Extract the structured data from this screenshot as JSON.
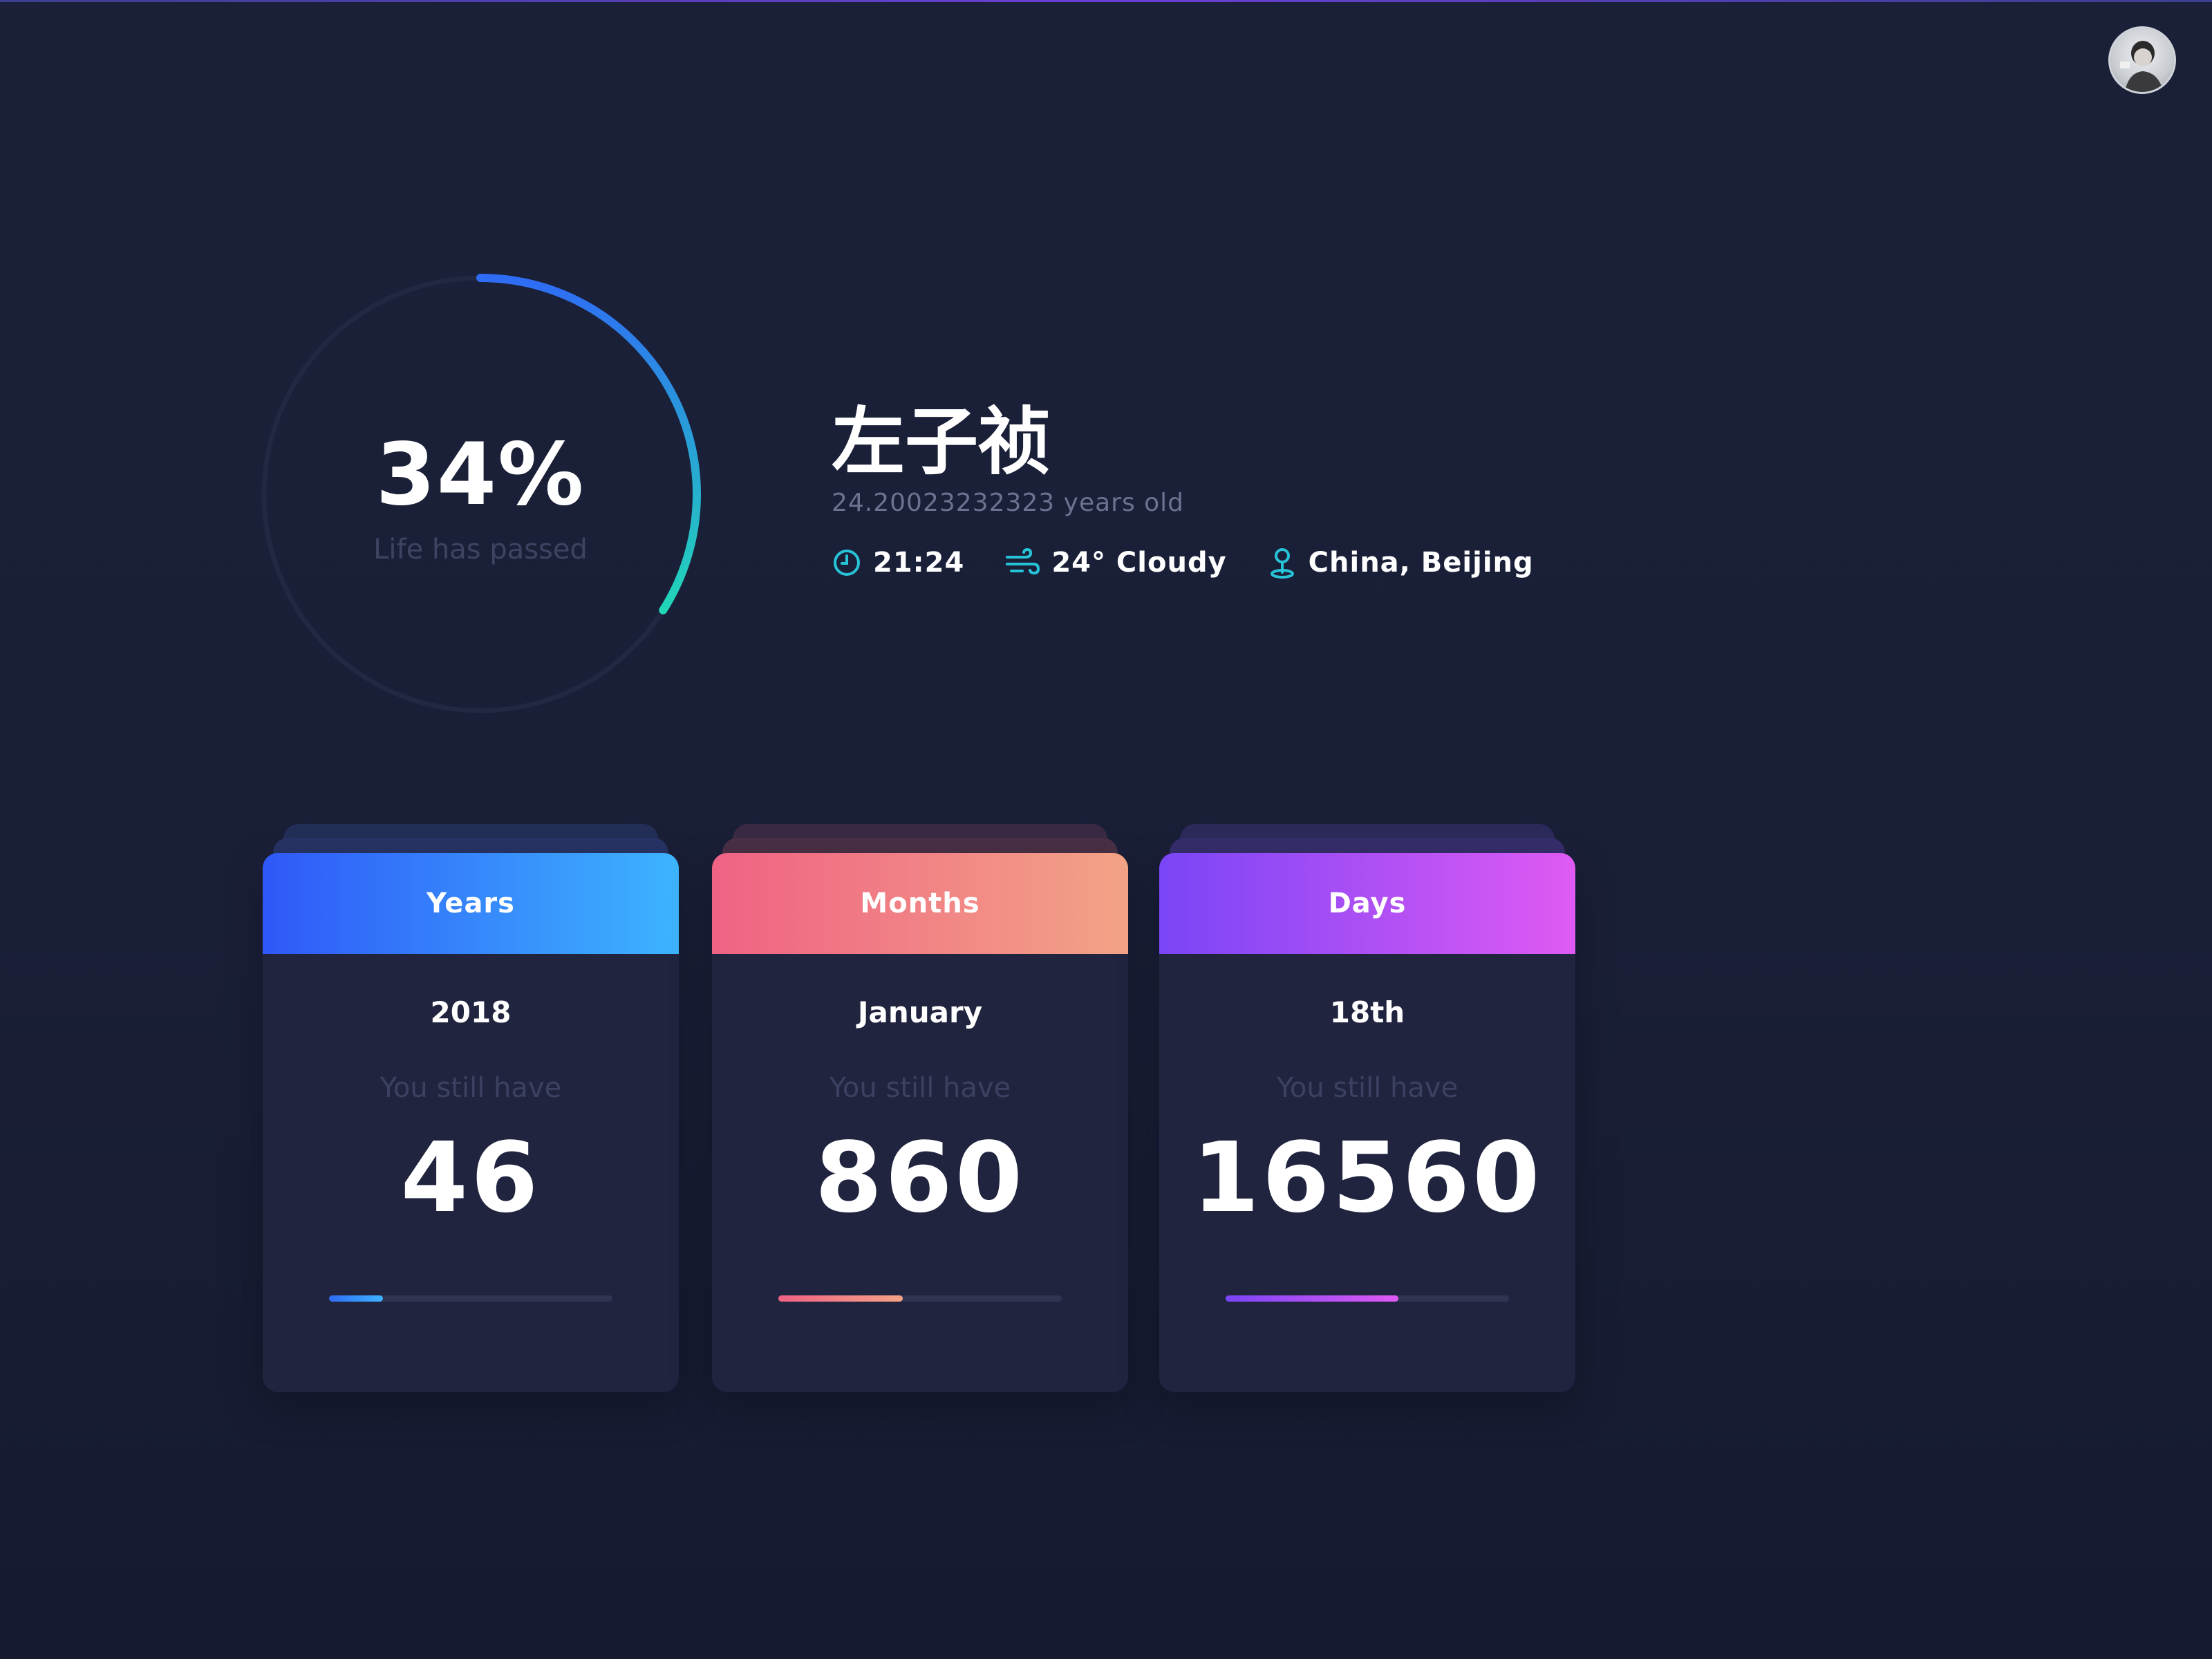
{
  "profile": {
    "name": "左子祯",
    "age": "24.20023232323 years old",
    "time": "21:24",
    "weather": "24° Cloudy",
    "location": "China, Beijing"
  },
  "life_ring": {
    "percent_label": "34%",
    "label": "Life has passed",
    "progress": 0.34,
    "colors": {
      "start": "#2f6cf5",
      "end": "#22d6b8",
      "track": "#222742"
    }
  },
  "cards": [
    {
      "title": "Years",
      "value": "2018",
      "still_label": "You still have",
      "remaining": "46",
      "progress": 0.19,
      "colors": {
        "head_start": "#2f58f8",
        "head_end": "#3db4fe",
        "bar_start": "#2f6cf5",
        "bar_end": "#3db4fe"
      }
    },
    {
      "title": "Months",
      "value": "January",
      "still_label": "You still have",
      "remaining": "860",
      "progress": 0.44,
      "colors": {
        "head_start": "#ef6284",
        "head_end": "#f3a386",
        "bar_start": "#ef6284",
        "bar_end": "#f3a386"
      }
    },
    {
      "title": "Days",
      "value": "18th",
      "still_label": "You still have",
      "remaining": "16560",
      "progress": 0.61,
      "colors": {
        "head_start": "#7a45f6",
        "head_end": "#df5af3",
        "bar_start": "#7a45f6",
        "bar_end": "#df5af3"
      }
    }
  ],
  "icons": {
    "time": "clock-icon",
    "weather": "wind-icon",
    "location": "location-pin-icon",
    "avatar": "user-avatar"
  }
}
